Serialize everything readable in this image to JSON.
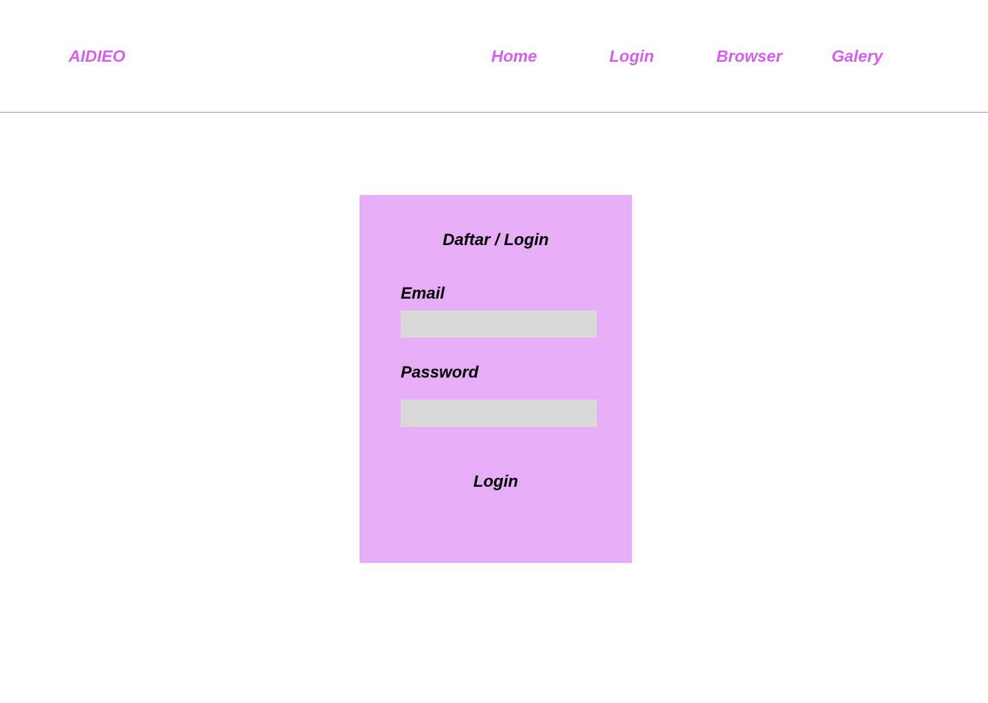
{
  "header": {
    "brand": "AIDIEO",
    "nav": [
      "Home",
      "Login",
      "Browser",
      "Galery"
    ]
  },
  "login_card": {
    "title": "Daftar / Login",
    "email_label": "Email",
    "password_label": "Password",
    "button_label": "Login"
  },
  "colors": {
    "accent": "#d65ff0",
    "card_bg": "#e8adf7",
    "input_bg": "#d9d9d9"
  }
}
